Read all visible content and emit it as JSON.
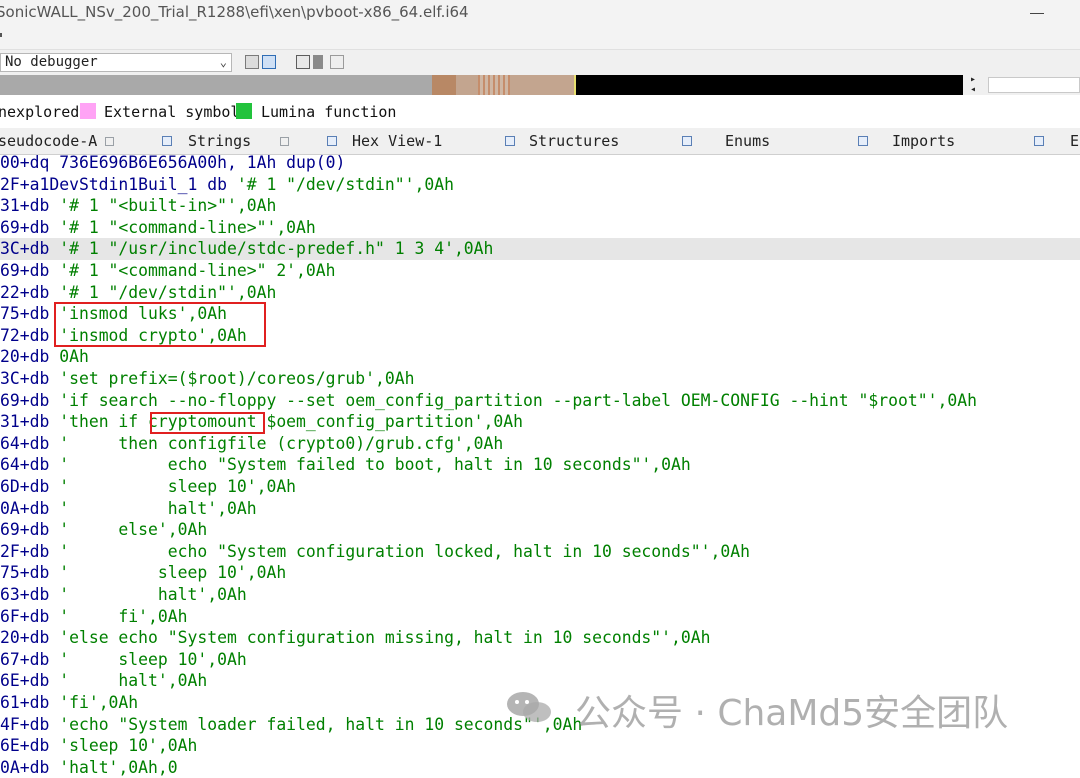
{
  "window": {
    "title": "SonicWALL_NSv_200_Trial_R1288\\efi\\xen\\pvboot-x86_64.elf.i64"
  },
  "toolbar": {
    "debugger": "No debugger"
  },
  "legend": {
    "items": [
      {
        "label": "nexplored",
        "color": ""
      },
      {
        "label": "External symbol",
        "color": "#ffa3f5"
      },
      {
        "label": "Lumina function",
        "color": "#22c33c"
      }
    ]
  },
  "tabs": [
    {
      "label": "seudocode-A"
    },
    {
      "label": "Strings"
    },
    {
      "label": "Hex View-1"
    },
    {
      "label": "Structures"
    },
    {
      "label": "Enums"
    },
    {
      "label": "Imports"
    },
    {
      "label": "E"
    }
  ],
  "code": {
    "highlight_line": 4,
    "lines": [
      {
        "prefix": "00+dq ",
        "text": "736E696B6E656A00h, 1Ah dup(0)"
      },
      {
        "prefix": "2F+a1DevStdin1Buil_1 db ",
        "text": "'# 1 \"/dev/stdin\"',0Ah"
      },
      {
        "prefix": "31+db ",
        "text": "'# 1 \"<built-in>\"',0Ah"
      },
      {
        "prefix": "69+db ",
        "text": "'# 1 \"<command-line>\"',0Ah"
      },
      {
        "prefix": "3C+db ",
        "text": "'# 1 \"/usr/include/stdc-predef.h\" 1 3 4',0Ah"
      },
      {
        "prefix": "69+db ",
        "text": "'# 1 \"<command-line>\" 2',0Ah"
      },
      {
        "prefix": "22+db ",
        "text": "'# 1 \"/dev/stdin\"',0Ah"
      },
      {
        "prefix": "75+db ",
        "text": "'insmod luks',0Ah"
      },
      {
        "prefix": "72+db ",
        "text": "'insmod crypto',0Ah"
      },
      {
        "prefix": "20+db ",
        "text": "0Ah"
      },
      {
        "prefix": "3C+db ",
        "text": "'set prefix=($root)/coreos/grub',0Ah"
      },
      {
        "prefix": "69+db ",
        "text": "'if search --no-floppy --set oem_config_partition --part-label OEM-CONFIG --hint \"$root\"',0Ah"
      },
      {
        "prefix": "31+db ",
        "text": "'then if cryptomount $oem_config_partition',0Ah"
      },
      {
        "prefix": "64+db ",
        "text": "'     then configfile (crypto0)/grub.cfg',0Ah"
      },
      {
        "prefix": "64+db ",
        "text": "'          echo \"System failed to boot, halt in 10 seconds\"',0Ah"
      },
      {
        "prefix": "6D+db ",
        "text": "'          sleep 10',0Ah"
      },
      {
        "prefix": "0A+db ",
        "text": "'          halt',0Ah"
      },
      {
        "prefix": "69+db ",
        "text": "'     else',0Ah"
      },
      {
        "prefix": "2F+db ",
        "text": "'          echo \"System configuration locked, halt in 10 seconds\"',0Ah"
      },
      {
        "prefix": "75+db ",
        "text": "'         sleep 10',0Ah"
      },
      {
        "prefix": "63+db ",
        "text": "'         halt',0Ah"
      },
      {
        "prefix": "6F+db ",
        "text": "'     fi',0Ah"
      },
      {
        "prefix": "20+db ",
        "text": "'else echo \"System configuration missing, halt in 10 seconds\"',0Ah"
      },
      {
        "prefix": "67+db ",
        "text": "'     sleep 10',0Ah"
      },
      {
        "prefix": "6E+db ",
        "text": "'     halt',0Ah"
      },
      {
        "prefix": "61+db ",
        "text": "'fi',0Ah"
      },
      {
        "prefix": "4F+db ",
        "text": "'echo \"System loader failed, halt in 10 seconds\"',0Ah"
      },
      {
        "prefix": "6E+db ",
        "text": "'sleep 10',0Ah"
      },
      {
        "prefix": "0A+db ",
        "text": "'halt',0Ah,0"
      }
    ]
  },
  "watermark": {
    "text": "公众号 · ChaMd5安全团队"
  }
}
